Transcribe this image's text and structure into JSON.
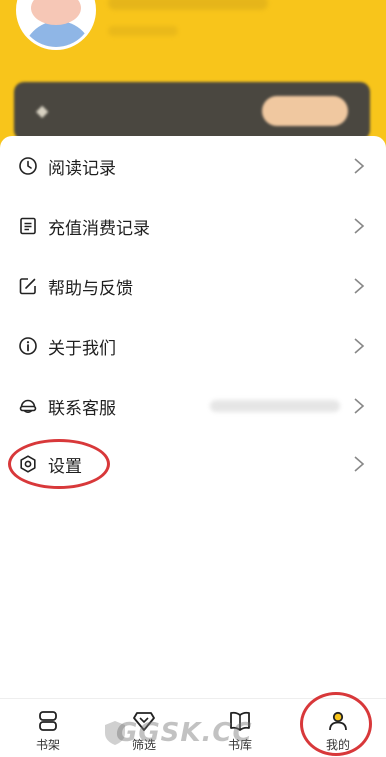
{
  "header": {
    "vip_label": "",
    "colors": {
      "background": "#f8c51b",
      "vip_card": "#4a4740"
    }
  },
  "menu": {
    "items": [
      {
        "label": "阅读记录",
        "icon": "clock-icon"
      },
      {
        "label": "充值消费记录",
        "icon": "receipt-icon"
      },
      {
        "label": "帮助与反馈",
        "icon": "edit-icon"
      },
      {
        "label": "关于我们",
        "icon": "info-icon"
      },
      {
        "label": "联系客服",
        "icon": "customer-service-icon"
      },
      {
        "label": "设置",
        "icon": "settings-icon"
      }
    ],
    "chevron_icon": "chevron-right-icon"
  },
  "tabbar": {
    "tabs": [
      {
        "label": "书架",
        "icon": "bookshelf-icon"
      },
      {
        "label": "筛选",
        "icon": "diamond-filter-icon"
      },
      {
        "label": "书库",
        "icon": "open-book-icon"
      },
      {
        "label": "我的",
        "icon": "user-icon"
      }
    ],
    "active_index": 3
  },
  "annotation": {
    "ring_color": "#d8383a"
  },
  "watermark": {
    "text": "GGSK.CC"
  }
}
